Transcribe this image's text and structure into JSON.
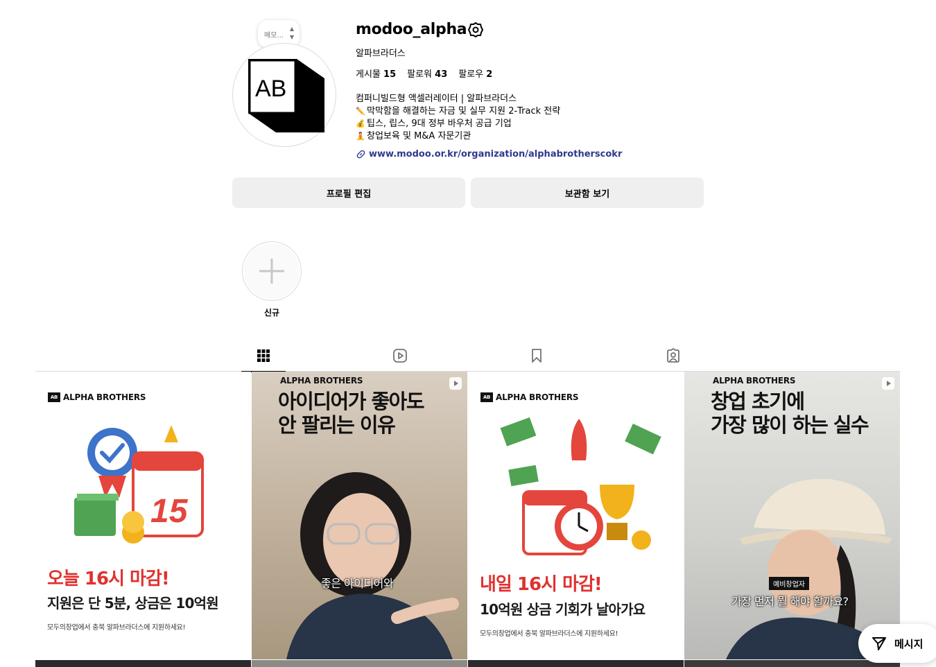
{
  "profile": {
    "username": "modoo_alpha",
    "full_name": "알파브라더스",
    "note_placeholder": "메모...",
    "stats": {
      "posts_label": "게시물",
      "posts_count": "15",
      "followers_label": "팔로워",
      "followers_count": "43",
      "following_label": "팔로우",
      "following_count": "2"
    },
    "bio": [
      "컴퍼니빌드형 액셀러레이터 | 알파브라더스",
      "막막함을 해결하는 자금 및 실무 지원 2-Track 전략",
      "팁스, 립스, 9대 정부 바우처 공급 기업",
      "창업보육 및 M&A 자문기관"
    ],
    "bio_emoji": [
      "✏️",
      "💰",
      "🧘"
    ],
    "link": "www.modoo.or.kr/organization/alphabrotherscokr",
    "avatar_logo_text": "AB"
  },
  "buttons": {
    "edit_profile": "프로필 편집",
    "view_archive": "보관함 보기"
  },
  "highlights": {
    "new_label": "신규"
  },
  "tabs": [
    "posts-grid-icon",
    "reels-icon",
    "saved-icon",
    "tagged-icon"
  ],
  "posts": [
    {
      "brand": "ALPHA BROTHERS",
      "headline_red": "오늘 16시 마감!",
      "headline_dark": "지원은 단 5분, 상금은 10억원",
      "note": "모두의창업에서 충북 알파브라더스에 지원하세요!",
      "calendar_number": "15"
    },
    {
      "brand": "ALPHA BROTHERS",
      "title_line1": "아이디어가 좋아도",
      "title_line2": "안 팔리는 이유",
      "subtitle": "좋은 아이디어와"
    },
    {
      "brand": "ALPHA BROTHERS",
      "headline_red": "내일 16시 마감!",
      "headline_dark": "10억원 상금 기회가 날아가요",
      "note": "모두의창업에서 충북 알파브라더스에 지원하세요!"
    },
    {
      "brand": "ALPHA BROTHERS",
      "title_line1": "창업 초기에",
      "title_line2": "가장 많이 하는 실수",
      "tag": "예비창업자",
      "subtitle": "가장 먼저 뭘 해야 할까요?"
    }
  ],
  "message_button": "메시지",
  "colors": {
    "accent_red": "#e0312f",
    "link_blue": "#2e3a8c",
    "button_bg": "#efefef"
  }
}
